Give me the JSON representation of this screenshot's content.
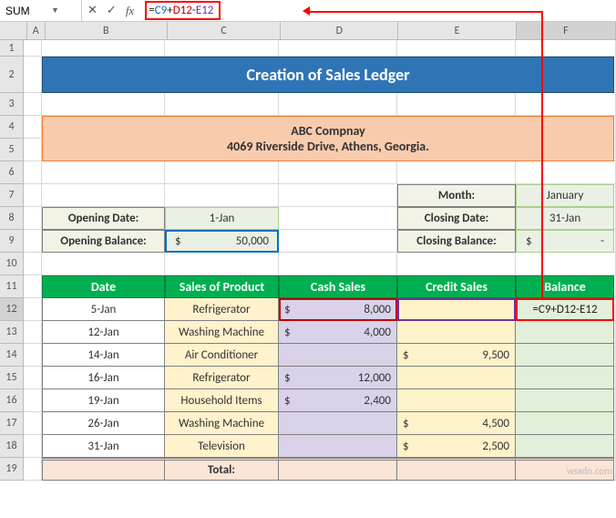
{
  "name_box": "SUM",
  "formula": "=C9+D12-E12",
  "columns": [
    "A",
    "B",
    "C",
    "D",
    "E",
    "F"
  ],
  "rows": [
    "1",
    "2",
    "3",
    "4",
    "5",
    "6",
    "7",
    "8",
    "9",
    "10",
    "11",
    "12",
    "13",
    "14",
    "15",
    "16",
    "17",
    "18",
    "19"
  ],
  "title": "Creation of Sales Ledger",
  "company": {
    "name": "ABC Compnay",
    "address": "4069 Riverside Drive, Athens, Georgia."
  },
  "labels": {
    "opening_date": "Opening Date:",
    "opening_balance": "Opening Balance:",
    "month": "Month:",
    "closing_date": "Closing Date:",
    "closing_balance": "Closing Balance:"
  },
  "values": {
    "opening_date": "1-Jan",
    "opening_balance_sym": "$",
    "opening_balance": "50,000",
    "month": "January",
    "closing_date": "31-Jan",
    "closing_balance_sym": "$",
    "closing_balance": "-"
  },
  "headers": {
    "date": "Date",
    "product": "Sales of Product",
    "cash": "Cash Sales",
    "credit": "Credit Sales",
    "balance": "Balance"
  },
  "table": [
    {
      "date": "5-Jan",
      "product": "Refrigerator",
      "cash_sym": "$",
      "cash": "8,000",
      "credit_sym": "",
      "credit": ""
    },
    {
      "date": "12-Jan",
      "product": "Washing Machine",
      "cash_sym": "$",
      "cash": "4,000",
      "credit_sym": "",
      "credit": ""
    },
    {
      "date": "14-Jan",
      "product": "Air Conditioner",
      "cash_sym": "",
      "cash": "",
      "credit_sym": "$",
      "credit": "9,500"
    },
    {
      "date": "16-Jan",
      "product": "Refrigerator",
      "cash_sym": "$",
      "cash": "12,000",
      "credit_sym": "",
      "credit": ""
    },
    {
      "date": "19-Jan",
      "product": "Household Items",
      "cash_sym": "$",
      "cash": "2,400",
      "credit_sym": "",
      "credit": ""
    },
    {
      "date": "26-Jan",
      "product": "Washing Machine",
      "cash_sym": "",
      "cash": "",
      "credit_sym": "$",
      "credit": "4,500"
    },
    {
      "date": "31-Jan",
      "product": "Television",
      "cash_sym": "",
      "cash": "",
      "credit_sym": "$",
      "credit": "2,500"
    }
  ],
  "total_label": "Total:",
  "active_cell_text": "=C9+D12-E12",
  "watermark": "wsxdn.com"
}
